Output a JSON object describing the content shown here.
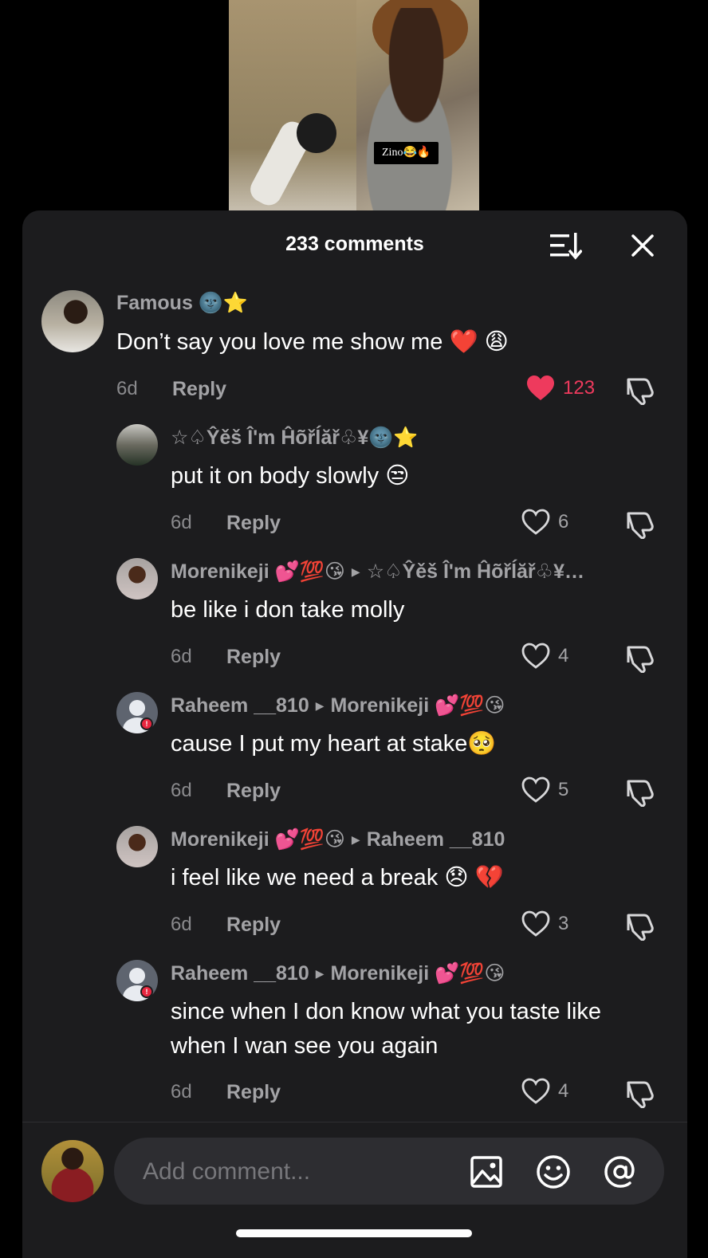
{
  "video": {
    "caption_tag": "Zino😂🔥"
  },
  "header": {
    "title": "233 comments"
  },
  "comments": [
    {
      "user": "Famous 🌚⭐",
      "reply_to": "",
      "text": "Don’t say you love me show me ❤️ 😩",
      "time": "6d",
      "reply": "Reply",
      "likes": "123",
      "liked": true
    },
    {
      "user": "☆♤Ŷěš Î'm Ĥõřĺăř♧¥🌚⭐",
      "reply_to": "",
      "text": "put it on body slowly 😒",
      "time": "6d",
      "reply": "Reply",
      "likes": "6",
      "liked": false
    },
    {
      "user": "Morenikeji 💕💯😘",
      "reply_to": "☆♤Ŷěš Î'm Ĥõřĺăř♧¥…",
      "text": "be like i don take molly",
      "time": "6d",
      "reply": "Reply",
      "likes": "4",
      "liked": false
    },
    {
      "user": "Raheem __810",
      "reply_to": "Morenikeji 💕💯😘",
      "text": "cause I put my heart at stake🥺",
      "time": "6d",
      "reply": "Reply",
      "likes": "5",
      "liked": false
    },
    {
      "user": "Morenikeji 💕💯😘",
      "reply_to": "Raheem __810",
      "text": "i feel like we need a break 😞 💔",
      "time": "6d",
      "reply": "Reply",
      "likes": "3",
      "liked": false
    },
    {
      "user": "Raheem __810",
      "reply_to": "Morenikeji 💕💯😘",
      "text": "since when I don know what you taste like when I wan see you again",
      "time": "6d",
      "reply": "Reply",
      "likes": "4",
      "liked": false
    }
  ],
  "composer": {
    "placeholder": "Add comment..."
  },
  "icons": {
    "sort": "sort-icon",
    "close": "close-icon",
    "heart": "heart-icon",
    "dislike": "thumbs-down-icon",
    "image": "image-icon",
    "emoji": "emoji-icon",
    "mention": "at-icon"
  },
  "colors": {
    "like_active": "#ee3a5d",
    "panel_bg": "#1c1c1e",
    "muted_text": "#a3a3a6"
  }
}
